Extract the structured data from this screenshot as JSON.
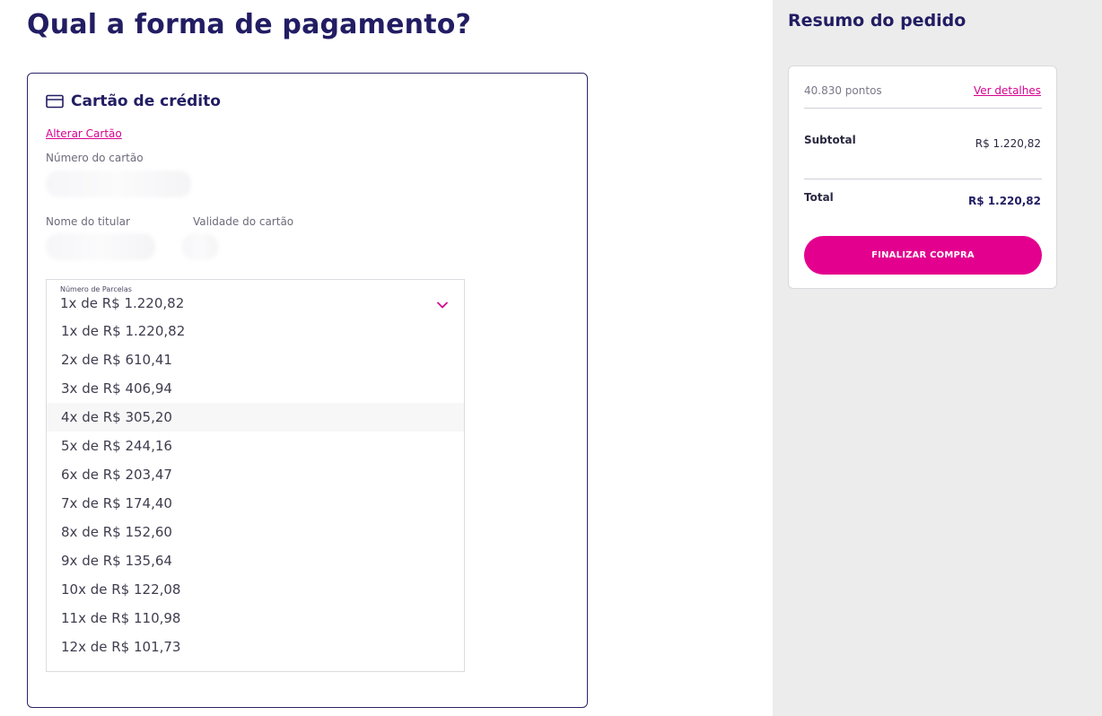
{
  "main": {
    "title": "Qual a forma de pagamento?",
    "card_section": {
      "title": "Cartão de crédito",
      "change_link": "Alterar Cartão",
      "card_number_label": "Número do cartão",
      "holder_label": "Nome do titular",
      "validity_label": "Validade do cartão"
    },
    "installments": {
      "label": "Número de Parcelas",
      "selected": "1x de R$ 1.220,82",
      "options": [
        "1x de R$ 1.220,82",
        "2x de R$ 610,41",
        "3x de R$ 406,94",
        "4x de R$ 305,20",
        "5x de R$ 244,16",
        "6x de R$ 203,47",
        "7x de R$ 174,40",
        "8x de R$ 152,60",
        "9x de R$ 135,64",
        "10x de R$ 122,08",
        "11x de R$ 110,98",
        "12x de R$ 101,73"
      ],
      "highlighted_index": 3
    }
  },
  "sidebar": {
    "title": "Resumo do pedido",
    "points": "40.830 pontos",
    "details_link": "Ver detalhes",
    "subtotal_label": "Subtotal",
    "subtotal_value": "R$ 1.220,82",
    "total_label": "Total",
    "total_value": "R$ 1.220,82",
    "finish_button": "FINALIZAR COMPRA"
  },
  "colors": {
    "brand_navy": "#221d63",
    "accent_pink": "#e4008f",
    "link_pink": "#d6028f",
    "sidebar_bg": "#ececec"
  },
  "icons": {
    "card": "credit-card-icon",
    "chevron": "chevron-down-icon"
  }
}
